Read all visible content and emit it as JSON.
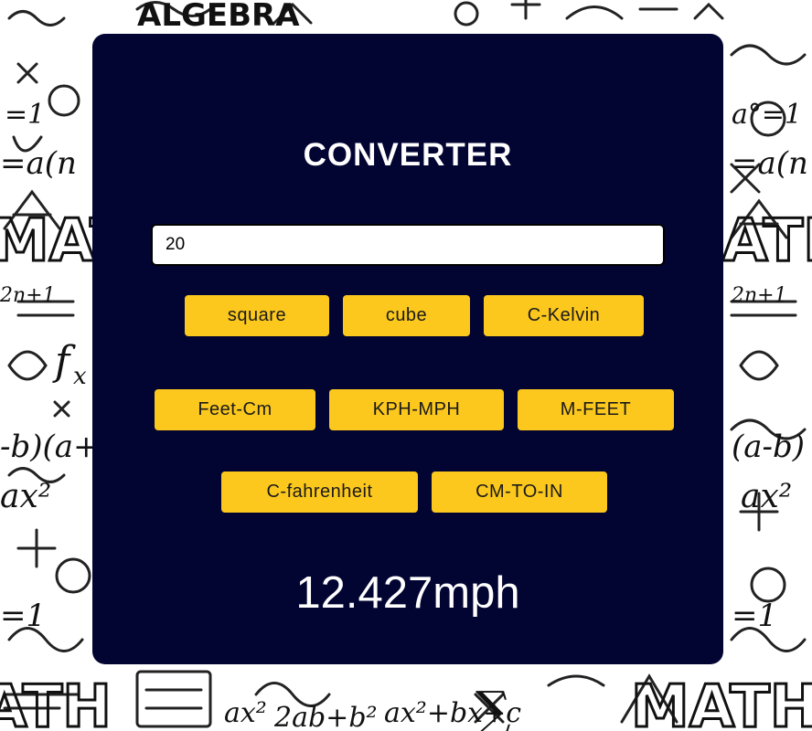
{
  "background": {
    "texts": [
      "ALGEBRA",
      "MATH",
      "fx",
      "ax²",
      "2n+1",
      "a(n",
      "-b)(a+",
      "=1"
    ]
  },
  "converter": {
    "title": "CONVERTER",
    "input_value": "20",
    "buttons_row1": [
      "square",
      "cube",
      "C-Kelvin"
    ],
    "buttons_row2": [
      "Feet-Cm",
      "KPH-MPH",
      "M-FEET"
    ],
    "buttons_row3": [
      "C-fahrenheit",
      "CM-TO-IN"
    ],
    "result": "12.427mph"
  },
  "colors": {
    "card": "#020532",
    "button": "#fcc81d",
    "text": "#ffffff"
  }
}
